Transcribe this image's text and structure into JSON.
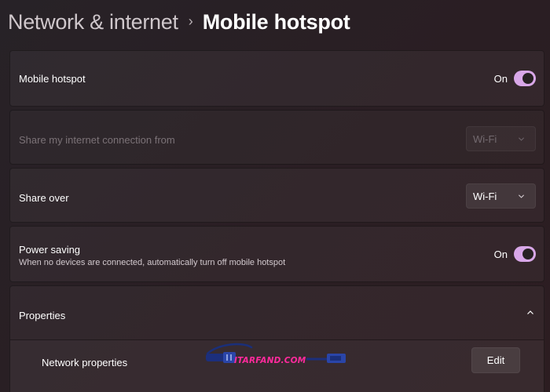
{
  "breadcrumb": {
    "parent": "Network & internet",
    "separator": "›",
    "current": "Mobile hotspot"
  },
  "mobile_hotspot": {
    "label": "Mobile hotspot",
    "toggle_state": "On",
    "toggle_on": true
  },
  "share_from": {
    "label": "Share my internet connection from",
    "value": "Wi-Fi",
    "disabled": true
  },
  "share_over": {
    "label": "Share over",
    "value": "Wi-Fi"
  },
  "power_saving": {
    "label": "Power saving",
    "description": "When no devices are connected, automatically turn off mobile hotspot",
    "toggle_state": "On",
    "toggle_on": true
  },
  "properties": {
    "label": "Properties",
    "expanded": true,
    "network_properties": {
      "label": "Network properties",
      "edit_label": "Edit"
    }
  },
  "watermark": {
    "text": "ITARFAND.COM"
  },
  "colors": {
    "accent": "#d8a7e8",
    "watermark": "#ff2a9d",
    "background": "#2a2024"
  },
  "icons": [
    "chevron-down-icon",
    "chevron-up-icon",
    "cable-icon"
  ]
}
